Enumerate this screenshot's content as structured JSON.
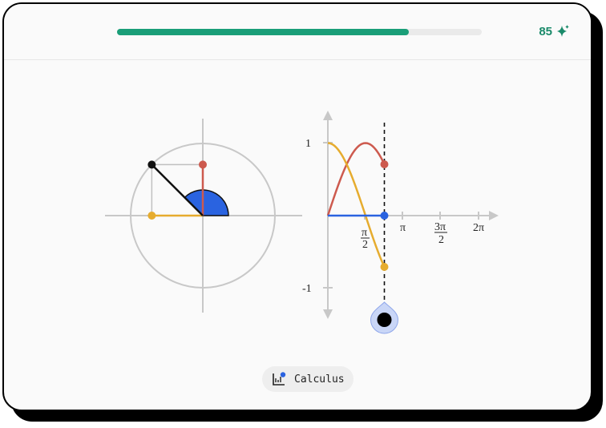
{
  "header": {
    "progress_percent": 80,
    "score": "85",
    "sparkle_icon": "sparkle-icon",
    "accent_color": "#1a9e78"
  },
  "unit_circle": {
    "angle_degrees": 135,
    "colors": {
      "sine": "#cd5a4e",
      "cosine": "#e6ac2e",
      "angle": "#2a63e0",
      "radius": "#111111"
    }
  },
  "graph": {
    "y_labels": {
      "top": "1",
      "bottom": "-1"
    },
    "x_labels": {
      "pi": "π",
      "half_pi_num": "π",
      "half_pi_den": "2",
      "three_half_pi_num": "3π",
      "three_half_pi_den": "2",
      "two_pi": "2π"
    },
    "handle_theta_fraction_of_pi": 0.75
  },
  "chip": {
    "label": "Calculus",
    "icon": "graph-icon"
  }
}
